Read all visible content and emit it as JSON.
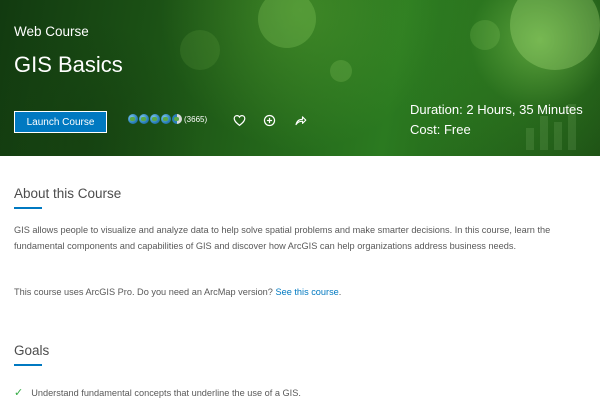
{
  "header": {
    "eyebrow": "Web Course",
    "title": "GIS Basics",
    "launch_label": "Launch Course",
    "rating_count": "(3665)",
    "rating_value": 4.5,
    "rating_max": 5,
    "duration": "Duration: 2 Hours, 35 Minutes",
    "cost": "Cost: Free",
    "icons": [
      "heart-icon",
      "add-circle-icon",
      "share-icon"
    ]
  },
  "about": {
    "heading": "About this Course",
    "description": "GIS allows people to visualize and analyze data to help solve spatial problems and make smarter decisions. In this course, learn the fundamental components and capabilities of GIS and discover how ArcGIS can help organizations address business needs.",
    "note_prefix": "This course uses ArcGIS Pro. Do you need an ArcMap version? ",
    "note_link": "See this course",
    "note_suffix": "."
  },
  "goals": {
    "heading": "Goals",
    "items": [
      "Understand fundamental concepts that underline the use of a GIS."
    ]
  },
  "colors": {
    "accent": "#0079c1",
    "check": "#35ac46",
    "hero_green": "#1f5a17"
  }
}
